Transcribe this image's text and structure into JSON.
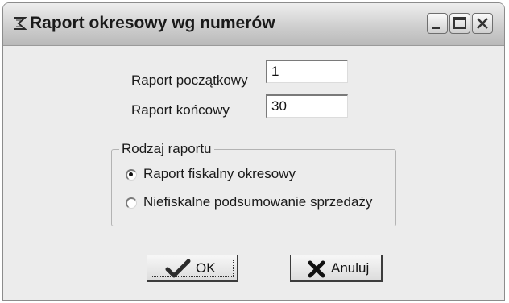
{
  "window": {
    "title": "Raport okresowy wg numerów"
  },
  "titlebar_icons": {
    "app": "app-icon",
    "minimize": "minimize-icon",
    "maximize": "maximize-icon",
    "close": "close-icon"
  },
  "form": {
    "start_label": "Raport początkowy",
    "start_value": "1",
    "end_label": "Raport końcowy",
    "end_value": "30"
  },
  "report_type": {
    "title": "Rodzaj raportu",
    "options": [
      {
        "label": "Raport fiskalny okresowy",
        "selected": true
      },
      {
        "label": "Niefiskalne podsumowanie sprzedaży",
        "selected": false
      }
    ]
  },
  "buttons": {
    "ok_label": "OK",
    "ok_icon": "checkmark-icon",
    "cancel_label": "Anuluj",
    "cancel_icon": "x-mark-icon"
  },
  "colors": {
    "window_bg": "#ececec",
    "title_text": "#1a1a1a"
  }
}
